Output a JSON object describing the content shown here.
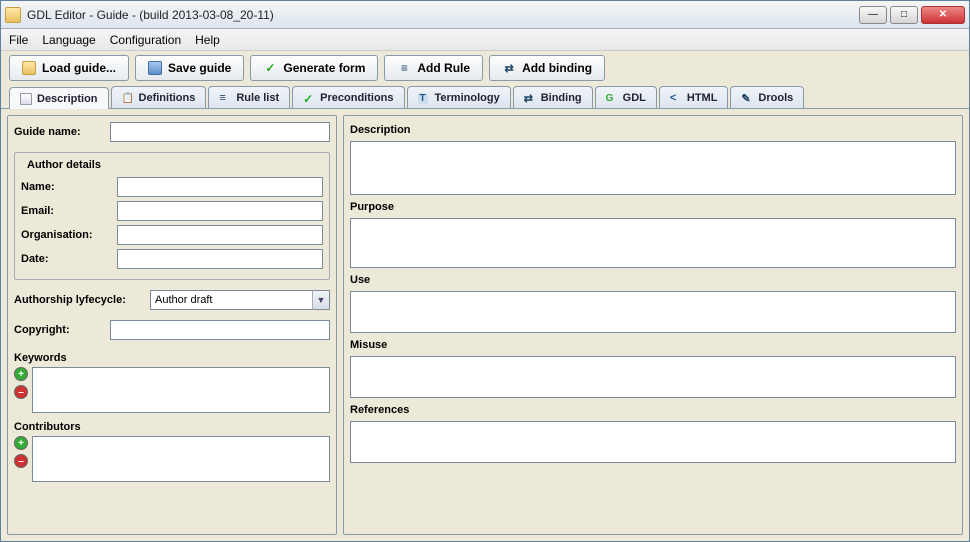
{
  "window": {
    "title": "GDL Editor - Guide - (build 2013-03-08_20-11)"
  },
  "menu": {
    "file": "File",
    "language": "Language",
    "configuration": "Configuration",
    "help": "Help"
  },
  "toolbar": {
    "load": "Load guide...",
    "save": "Save guide",
    "generate": "Generate form",
    "addrule": "Add Rule",
    "addbinding": "Add binding"
  },
  "tabs": {
    "description": "Description",
    "definitions": "Definitions",
    "rulelist": "Rule list",
    "preconditions": "Preconditions",
    "terminology": "Terminology",
    "binding": "Binding",
    "gdl": "GDL",
    "html": "HTML",
    "drools": "Drools"
  },
  "left": {
    "guide_name_label": "Guide name:",
    "guide_name": "",
    "author_details": "Author details",
    "name_label": "Name:",
    "name": "",
    "email_label": "Email:",
    "email": "",
    "org_label": "Organisation:",
    "org": "",
    "date_label": "Date:",
    "date": "",
    "lifecycle_label": "Authorship lyfecycle:",
    "lifecycle_value": "Author draft",
    "copyright_label": "Copyright:",
    "copyright": "",
    "keywords_label": "Keywords",
    "contributors_label": "Contributors"
  },
  "right": {
    "description_label": "Description",
    "description": "",
    "purpose_label": "Purpose",
    "purpose": "",
    "use_label": "Use",
    "use": "",
    "misuse_label": "Misuse",
    "misuse": "",
    "references_label": "References",
    "references": ""
  }
}
